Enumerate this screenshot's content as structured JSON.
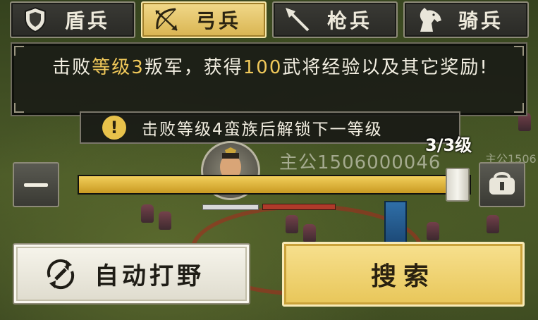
{
  "tabs": [
    {
      "label": "盾兵",
      "icon": "shield-icon",
      "active": false
    },
    {
      "label": "弓兵",
      "icon": "bow-arrow-icon",
      "active": true
    },
    {
      "label": "枪兵",
      "icon": "spear-icon",
      "active": false
    },
    {
      "label": "骑兵",
      "icon": "horse-icon",
      "active": false
    }
  ],
  "panel": {
    "text_part1": "击败",
    "text_hl1": "等级3",
    "text_part2": "叛军，获得",
    "text_hl2": "100",
    "text_part3": "武将经验以及其它奖励!"
  },
  "hint": {
    "icon_text": "!",
    "text": "击败等级4蛮族后解锁下一等级"
  },
  "level": {
    "text": "3/3级",
    "current": 3,
    "max": 3
  },
  "lord": {
    "name": "主公1506000046",
    "name_partial": "主公1506"
  },
  "slider": {
    "value": 1.0
  },
  "buttons": {
    "auto": "自动打野",
    "search": "搜索"
  },
  "colors": {
    "highlight": "#f0c85a",
    "tab_active": "#e6c56a",
    "search_button": "#eccd66"
  }
}
